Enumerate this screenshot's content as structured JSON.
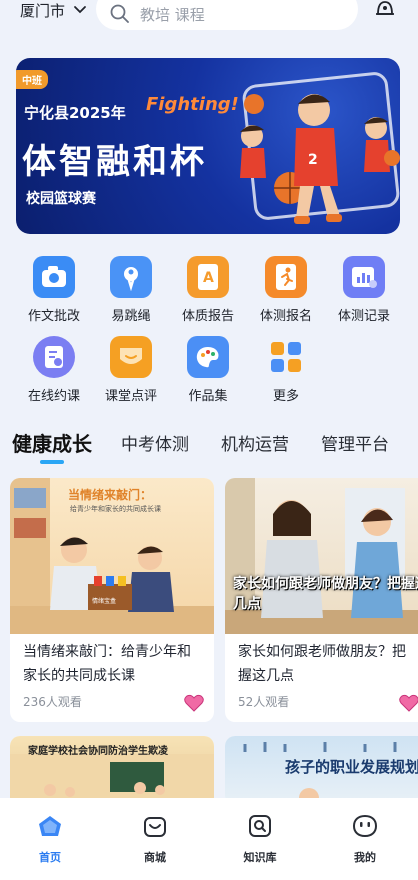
{
  "header": {
    "city": "厦门市",
    "search_placeholder": "教培 课程"
  },
  "banner": {
    "tag": "中班",
    "line1": "宁化县2025年",
    "fighting": "Fighting!",
    "title": "体智融和杯",
    "subtitle": "校园篮球赛"
  },
  "grid": [
    {
      "label": "作文批改",
      "icon": "camera-icon",
      "color": "#2f8bf5"
    },
    {
      "label": "易跳绳",
      "icon": "jump-rope-icon",
      "color": "#3d8ff7"
    },
    {
      "label": "体质报告",
      "icon": "report-a-icon",
      "color": "#f59b2c"
    },
    {
      "label": "体测报名",
      "icon": "runner-icon",
      "color": "#f58a2a"
    },
    {
      "label": "体测记录",
      "icon": "chart-record-icon",
      "color": "#6d7cf5"
    },
    {
      "label": "在线约课",
      "icon": "booking-icon",
      "color": "#7a7cf2"
    },
    {
      "label": "课堂点评",
      "icon": "comment-icon",
      "color": "#f5a023"
    },
    {
      "label": "作品集",
      "icon": "palette-icon",
      "color": "#4a8ff5"
    },
    {
      "label": "更多",
      "icon": "more-grid-icon",
      "color": "#f5a023"
    }
  ],
  "tabs": [
    "健康成长",
    "中考体测",
    "机构运营",
    "管理平台"
  ],
  "cards": [
    {
      "title": "当情绪来敲门：给青少年和家长的共同成长课",
      "views": "236人观看",
      "thumb_title": "当情绪来敲门：",
      "thumb_sub": "给青少年和家长的共同成长课",
      "box_label": "情绪宝盒"
    },
    {
      "title": "家长如何跟老师做朋友？把握这几点",
      "views": "52人观看",
      "thumb_overlay": "家长如何跟老师做朋友？把握这几点"
    },
    {
      "thumb_title": "家庭学校社会协同防治学生欺凌"
    },
    {
      "thumb_title": "孩子的职业发展规划"
    }
  ],
  "nav": [
    {
      "label": "首页",
      "icon": "home-icon"
    },
    {
      "label": "商城",
      "icon": "shop-bag-icon"
    },
    {
      "label": "知识库",
      "icon": "knowledge-icon"
    },
    {
      "label": "我的",
      "icon": "profile-icon"
    }
  ]
}
